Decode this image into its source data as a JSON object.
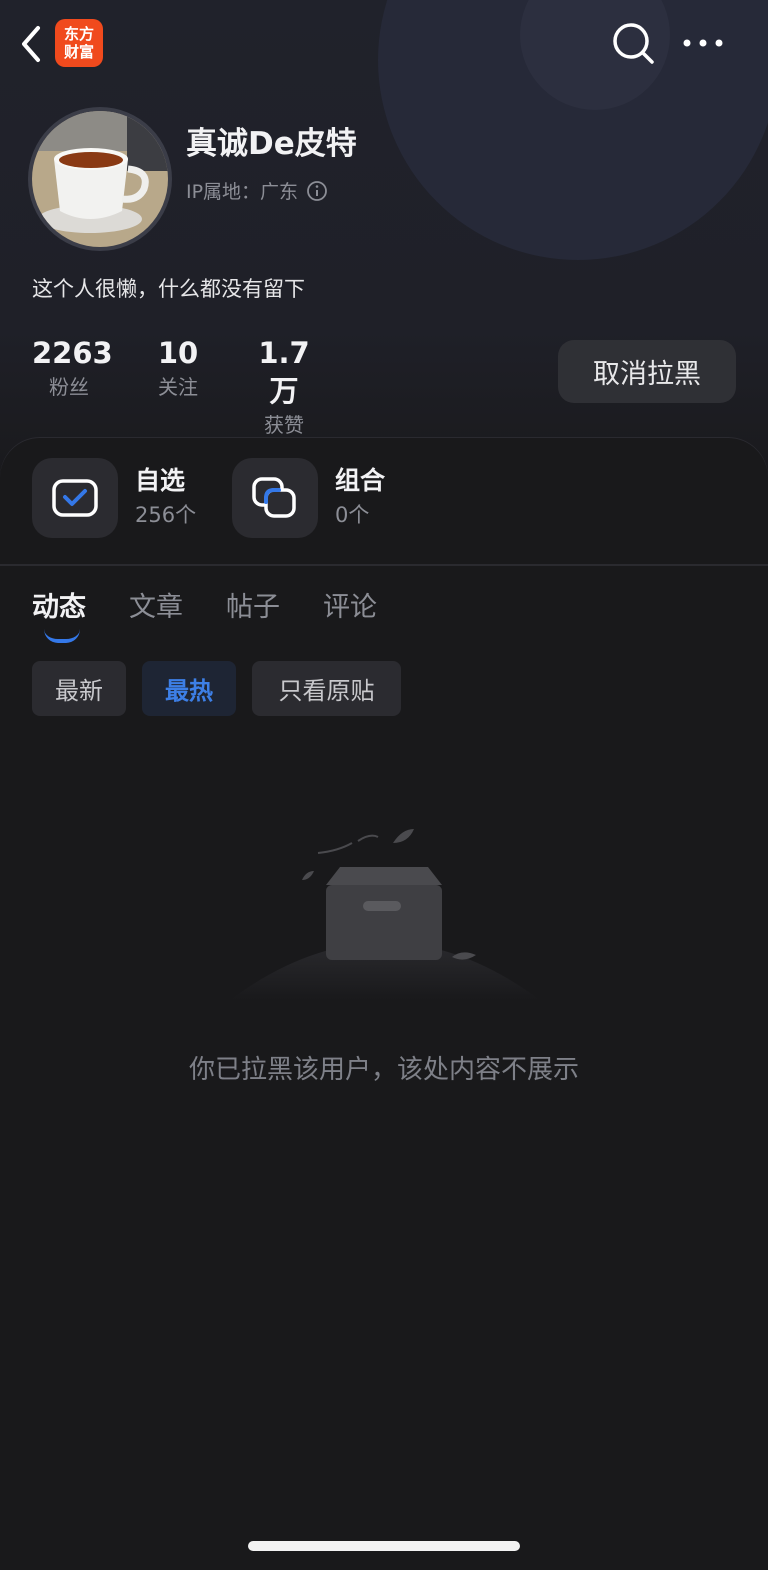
{
  "app": {
    "logo_line1": "东方",
    "logo_line2": "财富",
    "brand_color": "#f04a1d",
    "accent_color": "#3478e8"
  },
  "profile": {
    "username": "真诚De皮特",
    "ip_label": "IP属地：广东",
    "bio": "这个人很懒，什么都没有留下",
    "stats": [
      {
        "value": "2263",
        "label": "粉丝"
      },
      {
        "value": "10",
        "label": "关注"
      },
      {
        "value": "1.7万",
        "label": "获赞"
      }
    ],
    "unblock_label": "取消拉黑"
  },
  "shortcuts": [
    {
      "title": "自选",
      "count": "256个",
      "icon": "checkbox-icon"
    },
    {
      "title": "组合",
      "count": "0个",
      "icon": "portfolio-icon"
    }
  ],
  "tabs": [
    "动态",
    "文章",
    "帖子",
    "评论"
  ],
  "active_tab": 0,
  "filters": [
    "最新",
    "最热",
    "只看原贴"
  ],
  "active_filter": 1,
  "empty_state": {
    "message": "你已拉黑该用户，该处内容不展示",
    "icon": "empty-box-icon"
  }
}
